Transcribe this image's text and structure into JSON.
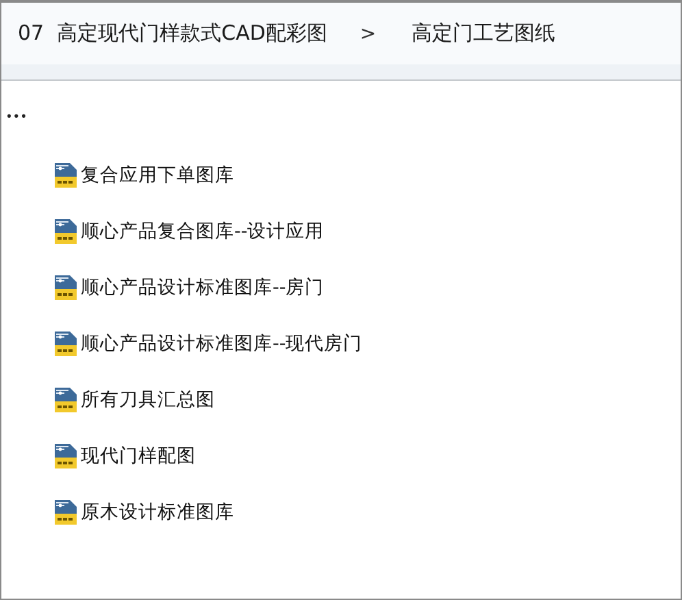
{
  "breadcrumb": {
    "items": [
      {
        "label": "07  高定现代门样款式CAD配彩图"
      },
      {
        "label": "高定门工艺图纸"
      }
    ],
    "separator": ">"
  },
  "more": "•••",
  "files": [
    {
      "name": "复合应用下单图库"
    },
    {
      "name": "顺心产品复合图库--设计应用"
    },
    {
      "name": "顺心产品设计标准图库--房门"
    },
    {
      "name": "顺心产品设计标准图库--现代房门"
    },
    {
      "name": "所有刀具汇总图"
    },
    {
      "name": "现代门样配图"
    },
    {
      "name": "原木设计标准图库"
    }
  ]
}
